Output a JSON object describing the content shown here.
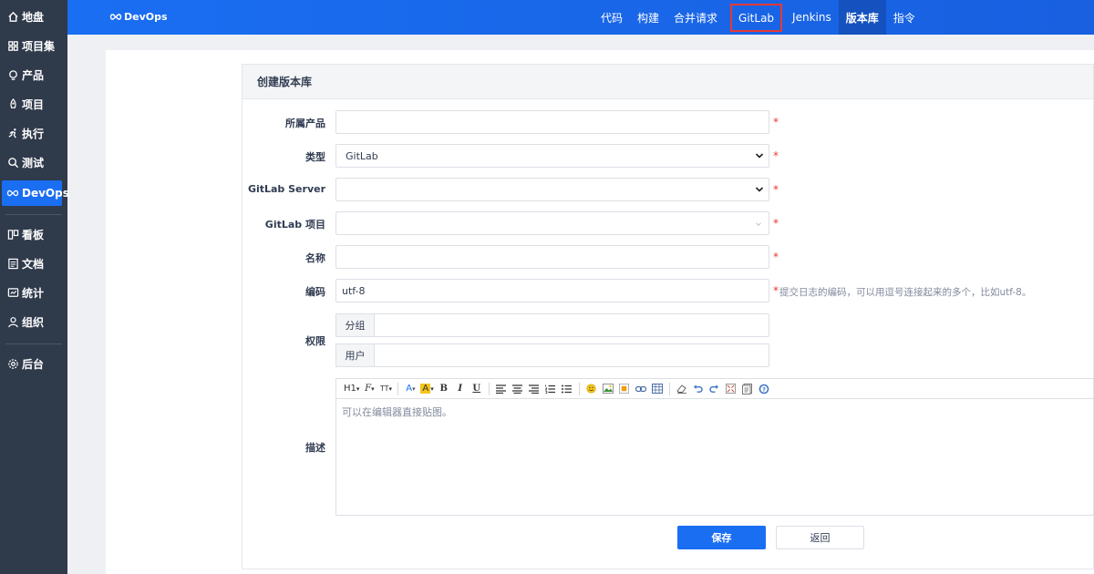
{
  "sidebar": {
    "items": [
      {
        "label": "地盘",
        "icon": "home-icon"
      },
      {
        "label": "项目集",
        "icon": "grid-icon"
      },
      {
        "label": "产品",
        "icon": "lightbulb-icon"
      },
      {
        "label": "项目",
        "icon": "rocket-icon"
      },
      {
        "label": "执行",
        "icon": "run-icon"
      },
      {
        "label": "测试",
        "icon": "search-icon"
      },
      {
        "label": "DevOps",
        "icon": "infinity-icon",
        "active": true
      },
      {
        "label": "看板",
        "icon": "kanban-icon"
      },
      {
        "label": "文档",
        "icon": "doc-icon"
      },
      {
        "label": "统计",
        "icon": "chart-icon"
      },
      {
        "label": "组织",
        "icon": "user-icon"
      },
      {
        "label": "后台",
        "icon": "gear-icon"
      }
    ]
  },
  "topbar": {
    "brand": "DevOps",
    "nav": [
      {
        "label": "代码"
      },
      {
        "label": "构建"
      },
      {
        "label": "合并请求"
      },
      {
        "label": "GitLab",
        "highlight": true
      },
      {
        "label": "Jenkins"
      },
      {
        "label": "版本库",
        "active": true
      },
      {
        "label": "指令"
      }
    ]
  },
  "form": {
    "title": "创建版本库",
    "product_label": "所属产品",
    "product_value": "",
    "type_label": "类型",
    "type_value": "GitLab",
    "server_label": "GitLab Server",
    "server_value": "",
    "project_label": "GitLab 项目",
    "project_value": "",
    "name_label": "名称",
    "name_value": "",
    "encoding_label": "编码",
    "encoding_value": "utf-8",
    "encoding_hint": "提交日志的编码，可以用逗号连接起来的多个，比如utf-8。",
    "acl_label": "权限",
    "acl_group_label": "分组",
    "acl_user_label": "用户",
    "desc_label": "描述",
    "desc_placeholder": "可以在编辑器直接贴图。",
    "required_mark": "*",
    "save_label": "保存",
    "back_label": "返回"
  },
  "editor_toolbar": {
    "heading": "H1",
    "font_family": "F",
    "font_size": "TT",
    "font_color": "A",
    "bg_color": "A",
    "bold": "B",
    "italic": "I",
    "underline": "U"
  },
  "colors": {
    "sidebar_bg": "#2f3a4b",
    "accent": "#1a6ef2",
    "required": "#e53935",
    "highlight_border": "#e53935"
  }
}
